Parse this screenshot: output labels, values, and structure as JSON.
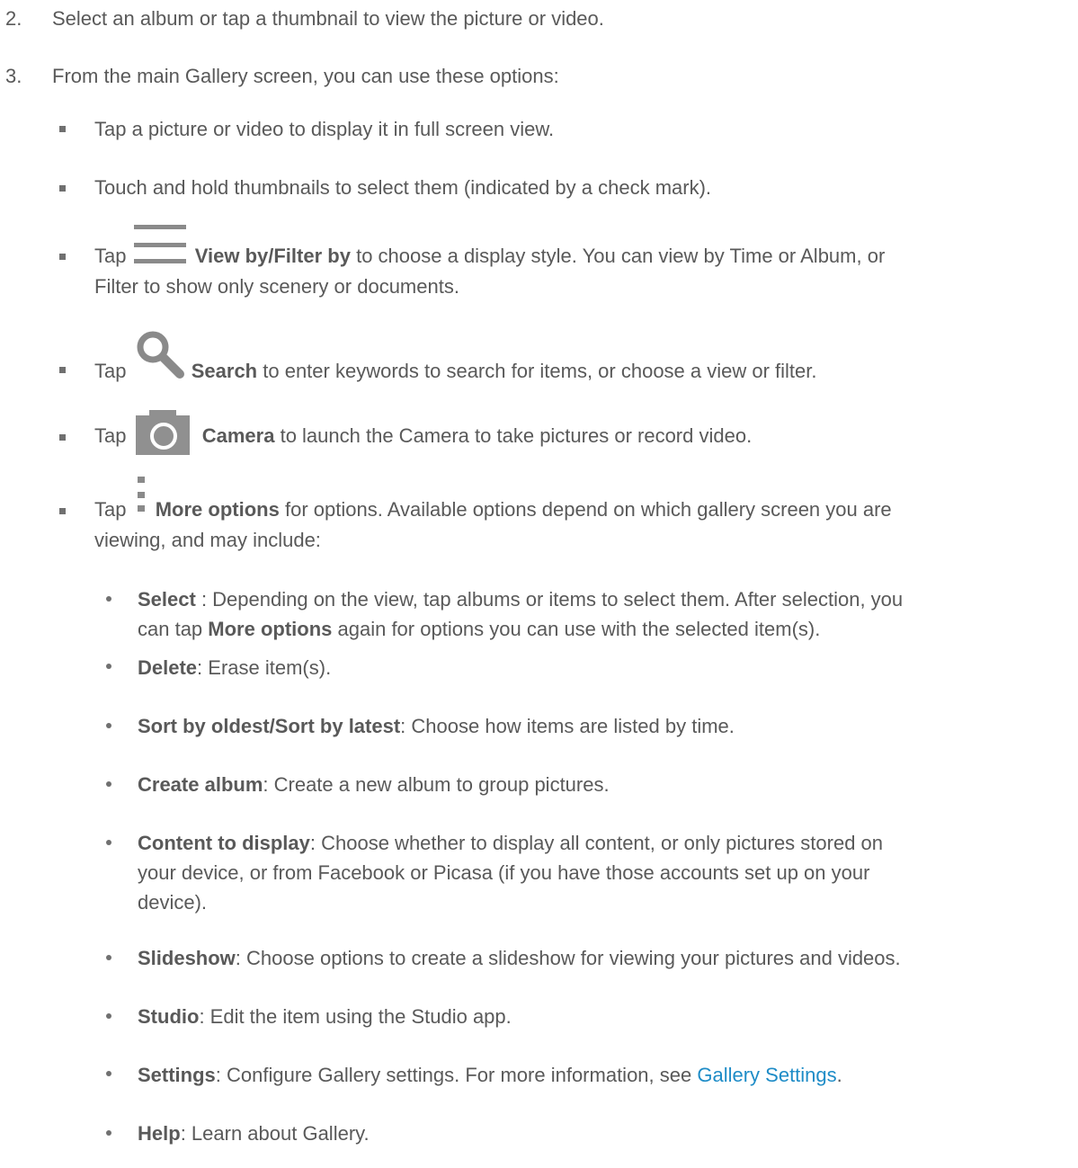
{
  "steps": [
    {
      "number": "2.",
      "text": "Select an album or tap a thumbnail to view the picture or video."
    },
    {
      "number": "3.",
      "text": "From the main Gallery screen, you can use these options:"
    }
  ],
  "bullets": {
    "full_screen": "Tap a picture or video to display it in full screen view.",
    "touch_hold": "Touch and hold thumbnails to select them (indicated by a check mark).",
    "viewby_pre": "Tap",
    "viewby_bold": "View by/Filter by",
    "viewby_post": "to choose a display style. You can view by Time or Album, or",
    "viewby_line2": "Filter to show only scenery or documents.",
    "search_pre": "Tap",
    "search_bold": "Search",
    "search_post": "to enter keywords to search for items, or choose a view or filter.",
    "camera_pre": "Tap",
    "camera_bold": "Camera",
    "camera_post": "to launch the Camera to take pictures or record video.",
    "more_pre": "Tap",
    "more_bold": "More options",
    "more_post": "for options. Available options depend on which gallery screen you are",
    "more_line2": "viewing, and may include:"
  },
  "icons": {
    "viewby": "menu-icon",
    "search": "search-icon",
    "camera": "camera-icon",
    "more": "more-options-icon"
  },
  "options": {
    "select_bold": "Select",
    "select_text": " : Depending on the view, tap albums or items to select them. After selection, you",
    "select_line2_pre": "can tap ",
    "select_line2_bold": "More options",
    "select_line2_post": " again for options you can use with the selected item(s).",
    "delete_bold": "Delete",
    "delete_text": ": Erase item(s).",
    "sort_bold": "Sort by oldest/Sort by latest",
    "sort_text": ": Choose how items are listed by time.",
    "create_bold": "Create album",
    "create_text": ": Create a new album to group pictures.",
    "content_bold": "Content to display",
    "content_text": ": Choose whether to display all content, or only pictures stored on",
    "content_line2": "your device, or from Facebook or Picasa (if you have those accounts set up on your",
    "content_line3": "device).",
    "slideshow_bold": "Slideshow",
    "slideshow_text": ": Choose options to create a slideshow for viewing your pictures and videos.",
    "studio_bold": "Studio",
    "studio_text": ": Edit the item using the Studio app.",
    "settings_bold": "Settings",
    "settings_text": ": Configure Gallery settings. For more information, see ",
    "settings_link": "Gallery Settings",
    "settings_end": ".",
    "help_bold": "Help",
    "help_text": ": Learn about Gallery."
  },
  "colors": {
    "text": "#595959",
    "link": "#1e8cc7",
    "icon": "#8a8a8a"
  }
}
